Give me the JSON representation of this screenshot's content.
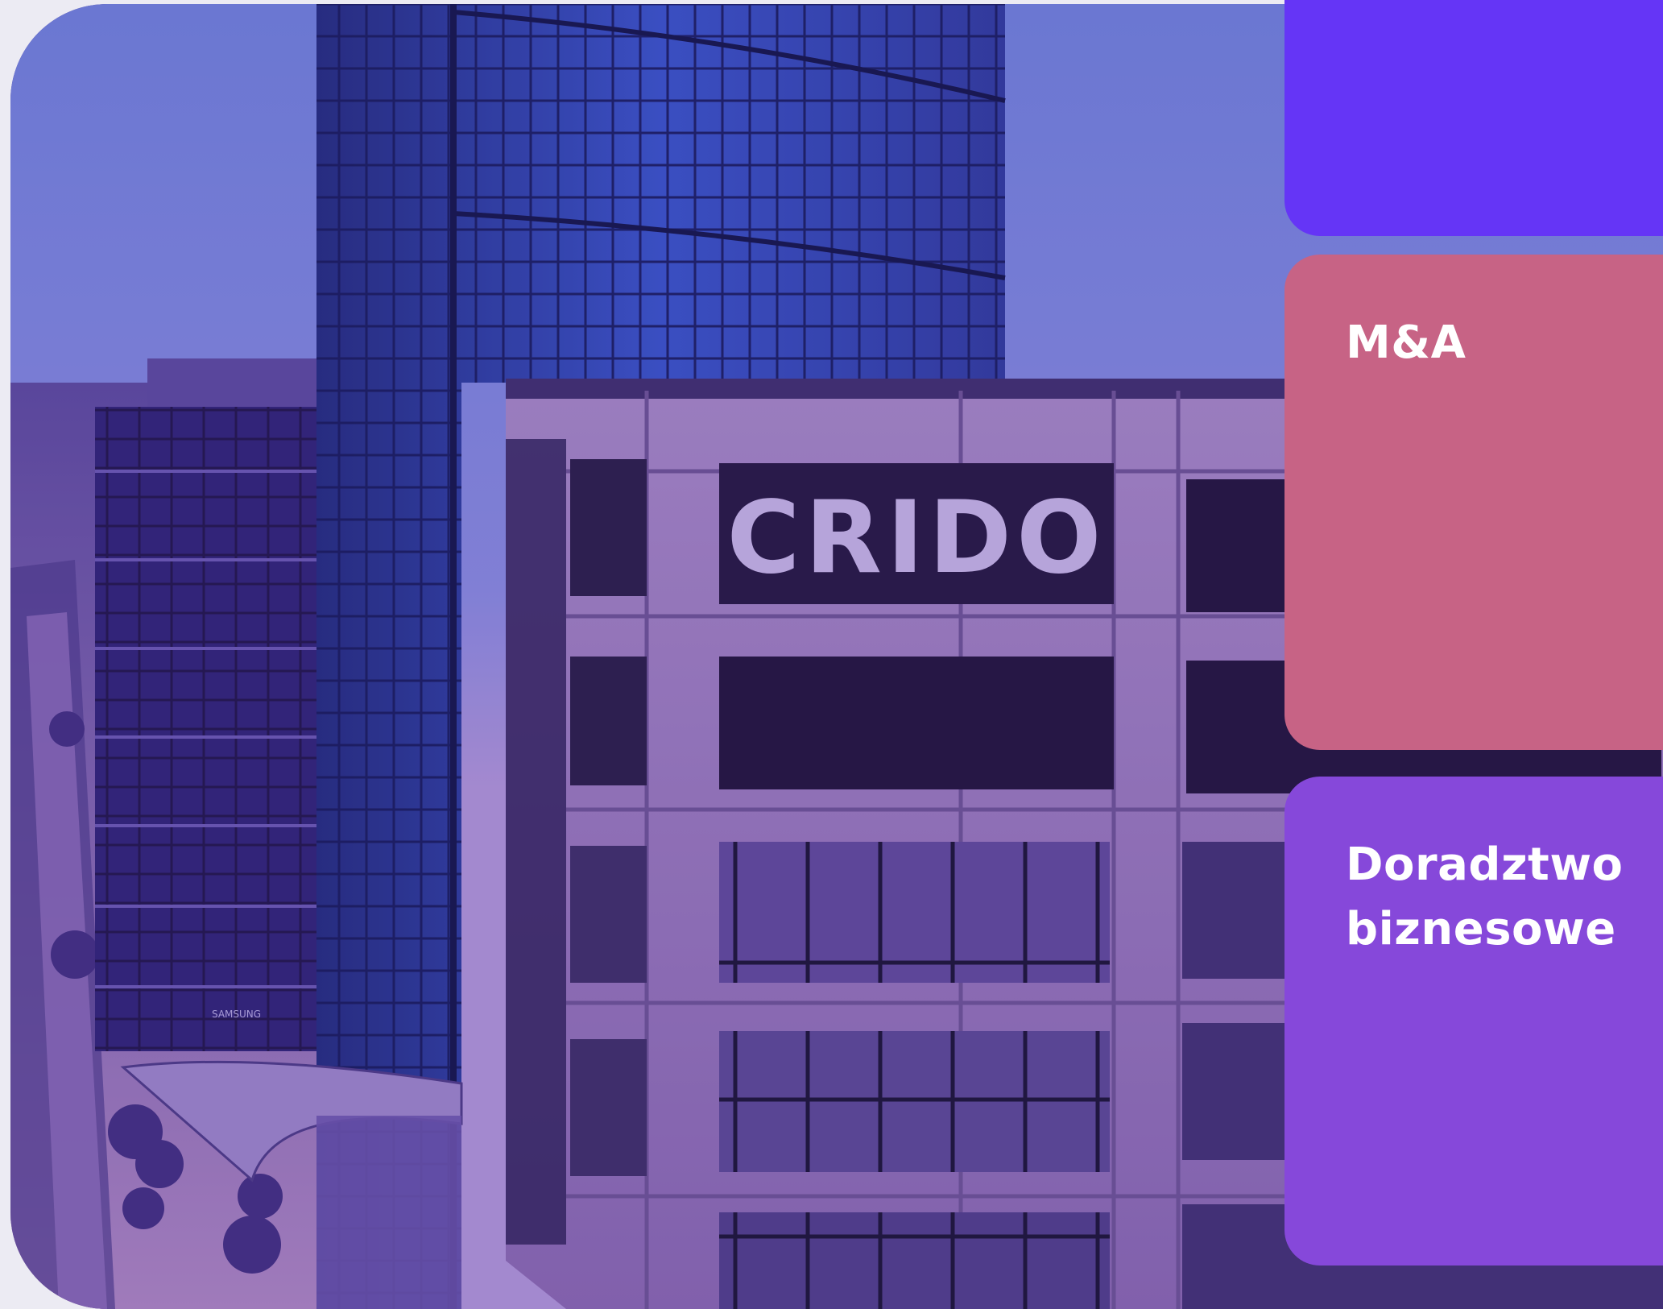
{
  "hero": {
    "sign_text": "CRIDO",
    "store_sign_text": "SAMSUNG"
  },
  "cards": [
    {
      "title": "",
      "color": "#6535f6"
    },
    {
      "title": "M&A",
      "color": "#c76385"
    },
    {
      "title": "Doradztwo biznesowe",
      "color": "#8648da"
    }
  ],
  "colors": {
    "background": "#ecebf3",
    "photo_tint": "#5a3aa8"
  }
}
